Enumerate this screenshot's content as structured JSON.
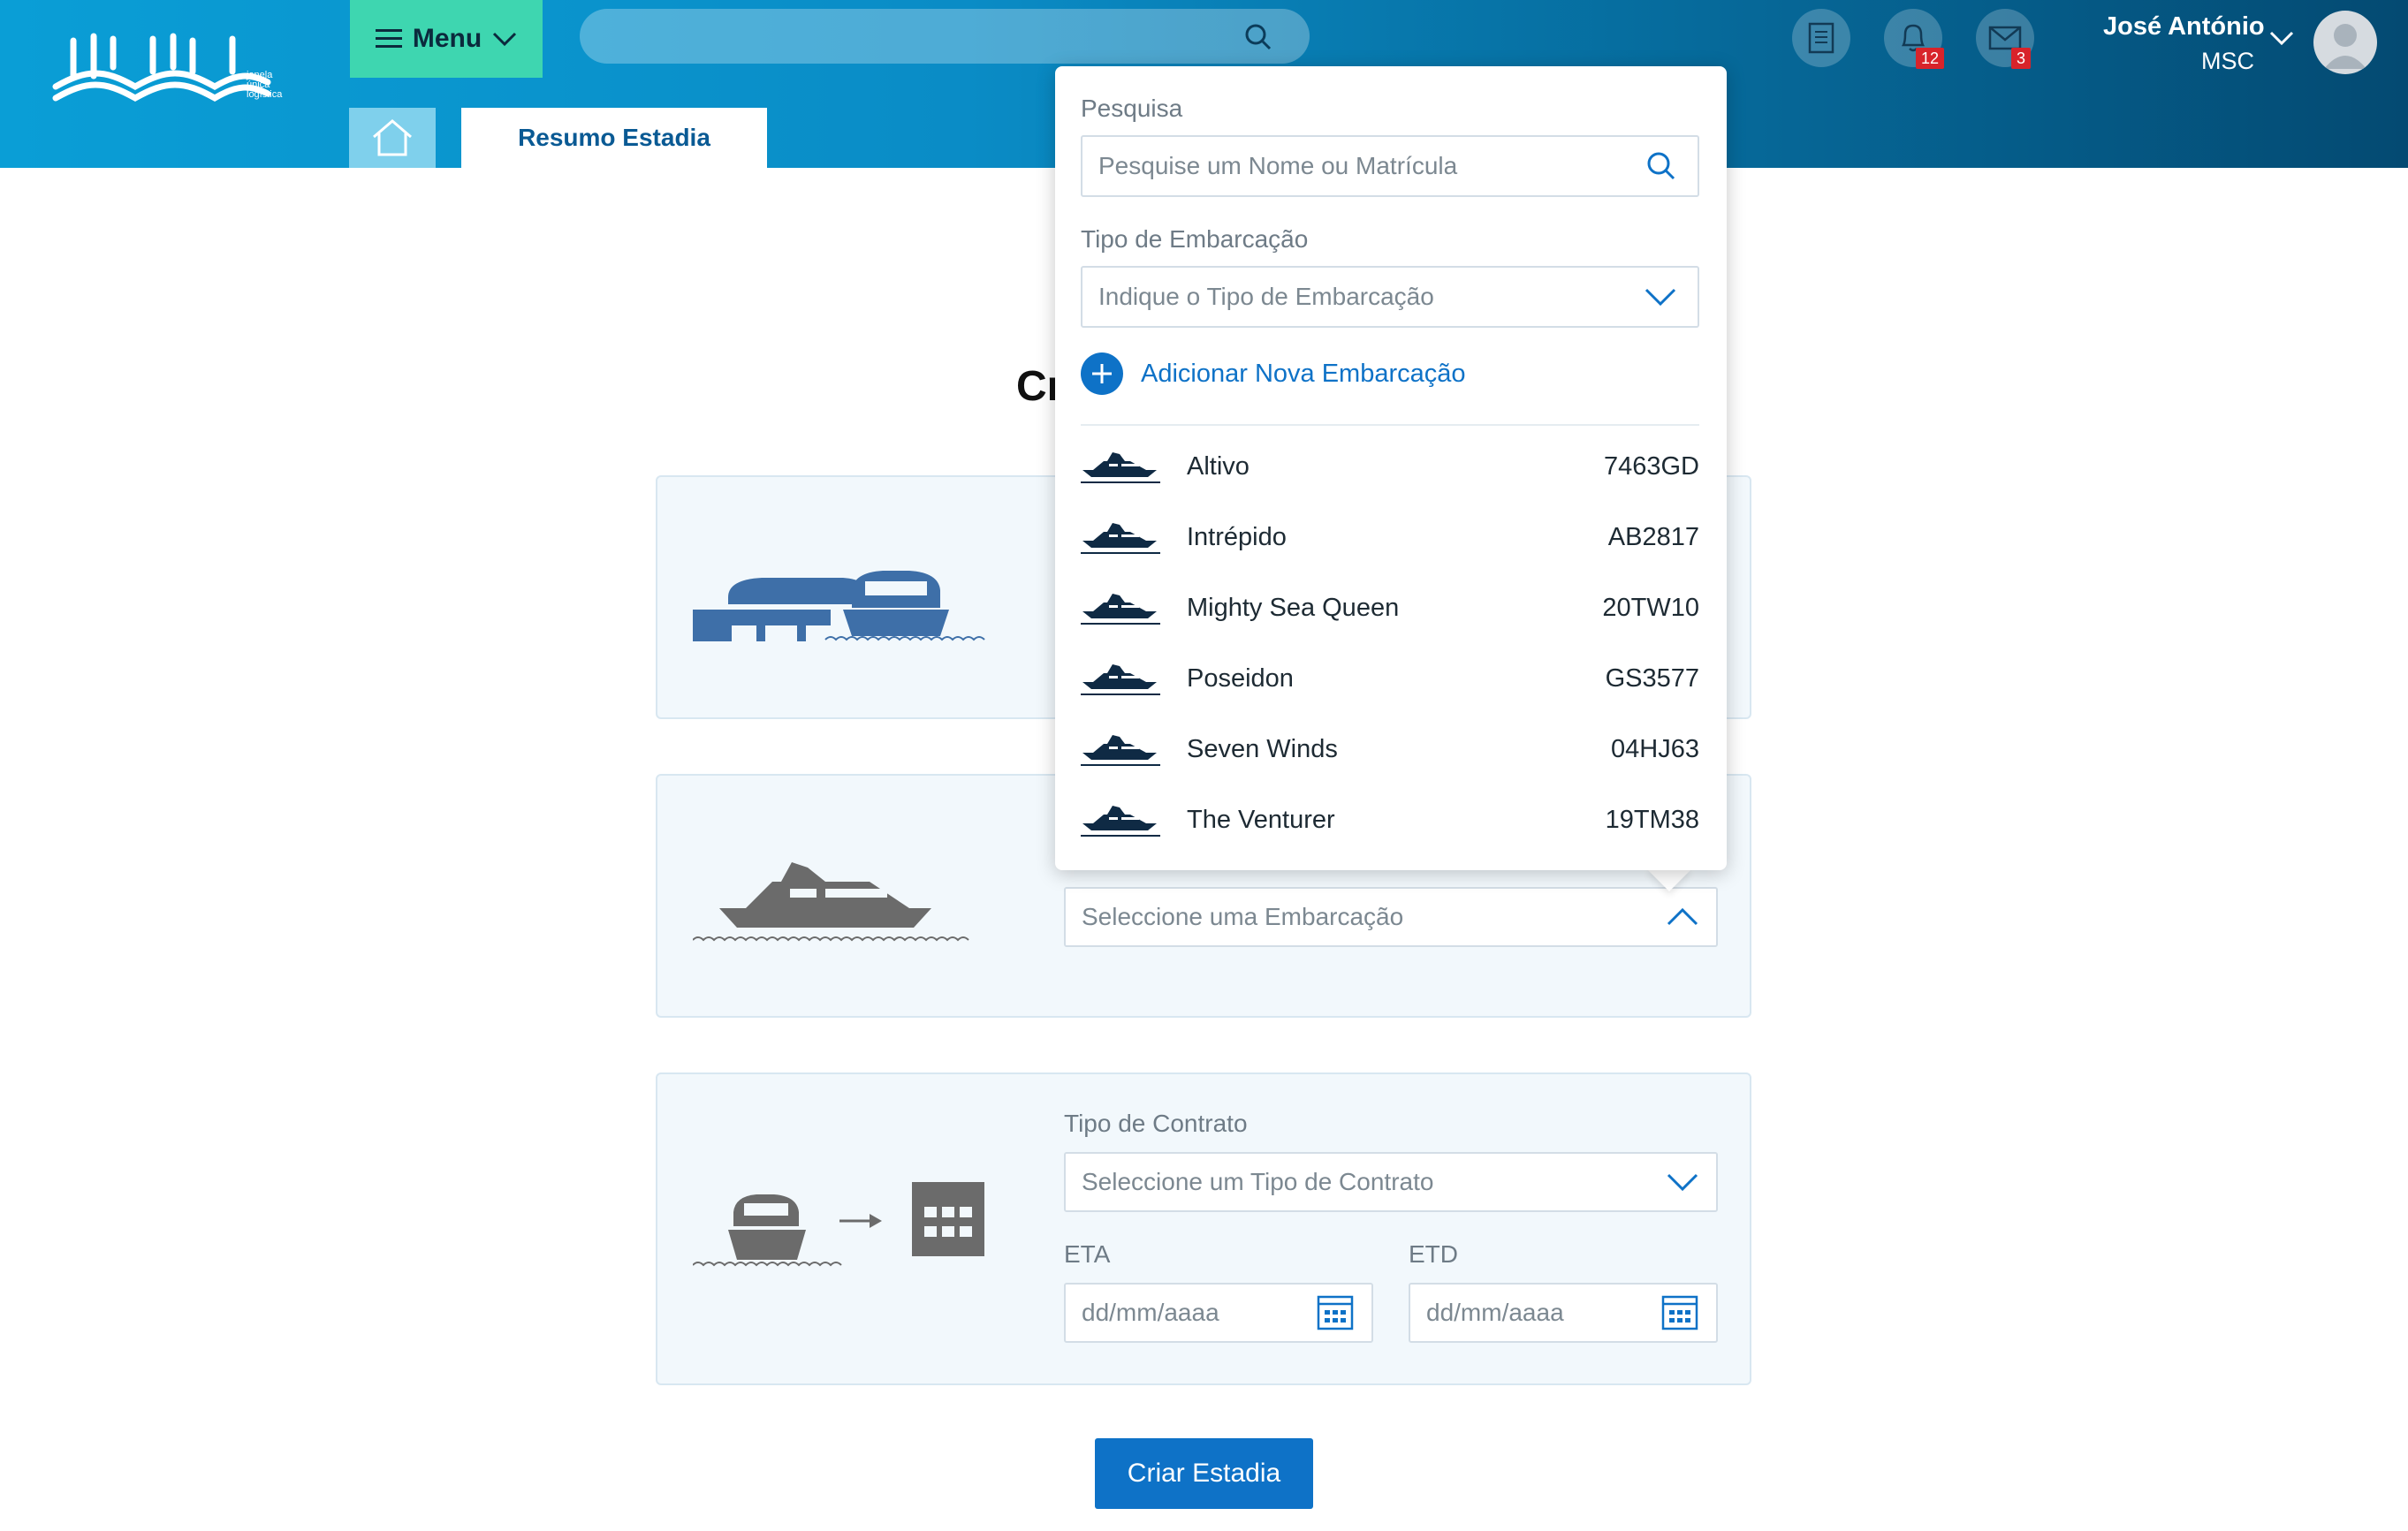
{
  "header": {
    "logo_text_lines": [
      "janela",
      "única",
      "logística"
    ],
    "menu_label": "Menu",
    "notifications_count": "12",
    "messages_count": "3",
    "user_name": "José António",
    "user_org": "MSC"
  },
  "tabs": {
    "resumo": "Resumo Estadia"
  },
  "main": {
    "title_visible": "Cr",
    "vessel_field_placeholder": "Seleccione uma Embarcação",
    "contract_label": "Tipo de Contrato",
    "contract_placeholder": "Seleccione um Tipo de Contrato",
    "eta_label": "ETA",
    "etd_label": "ETD",
    "date_placeholder": "dd/mm/aaaa",
    "create_button": "Criar Estadia"
  },
  "popup": {
    "search_label": "Pesquisa",
    "search_placeholder": "Pesquise um Nome ou Matrícula",
    "type_label": "Tipo de Embarcação",
    "type_placeholder": "Indique o Tipo de Embarcação",
    "add_label": "Adicionar Nova Embarcação",
    "vessels": [
      {
        "name": "Altivo",
        "code": "7463GD"
      },
      {
        "name": "Intrépido",
        "code": "AB2817"
      },
      {
        "name": "Mighty Sea Queen",
        "code": "20TW10"
      },
      {
        "name": "Poseidon",
        "code": "GS3577"
      },
      {
        "name": "Seven Winds",
        "code": "04HJ63"
      },
      {
        "name": "The Venturer",
        "code": "19TM38"
      }
    ]
  },
  "colors": {
    "accent": "#0e72c7",
    "menu_bg": "#3ed6b0",
    "badge": "#d8232a"
  }
}
